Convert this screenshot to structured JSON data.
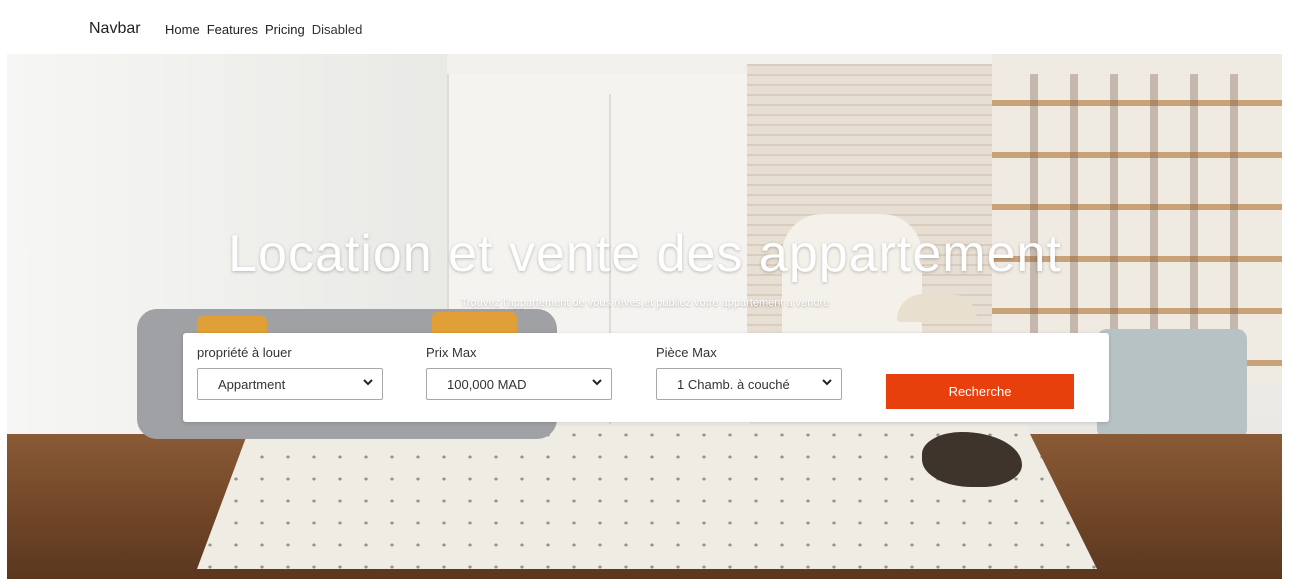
{
  "navbar": {
    "brand": "Navbar",
    "links": [
      "Home",
      "Features",
      "Pricing",
      "Disabled"
    ]
  },
  "hero": {
    "title": "Location et vente des appartement",
    "subtitle": "Trouvez l'appartement de vous rèves,et publiez votre appartement a vendre"
  },
  "search": {
    "fields": [
      {
        "label": "propriété à louer",
        "value": "Appartment"
      },
      {
        "label": "Prix Max",
        "value": "100,000 MAD"
      },
      {
        "label": "Pièce Max",
        "value": "1 Chamb. à couché"
      }
    ],
    "button_label": "Recherche",
    "accent_color": "#e8400c"
  }
}
